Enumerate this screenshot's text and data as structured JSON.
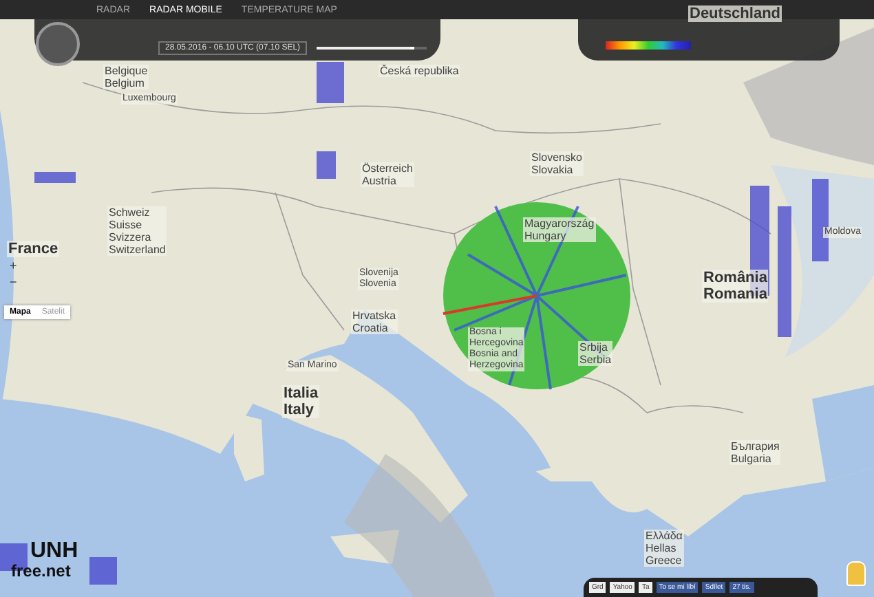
{
  "top_bar": {
    "tabs": [
      {
        "label": "RADAR",
        "selected": false
      },
      {
        "label": "RADAR MOBILE",
        "selected": true
      },
      {
        "label": "TEMPERATURE MAP",
        "selected": false
      }
    ]
  },
  "controls": {
    "date_range": "28.05.2016 - 06.10 UTC (07.10 SEL)",
    "opacity": {
      "level": 0.85
    }
  },
  "zoom": {
    "in": "+",
    "out": "−"
  },
  "map_types": [
    {
      "label": "Mapa",
      "selected": true
    },
    {
      "label": "Satelit",
      "selected": false
    }
  ],
  "map_labels": [
    {
      "text": "Deutschland",
      "kind": "big"
    },
    {
      "text": "Belgique\nBelgium",
      "kind": "country"
    },
    {
      "text": "Luxembourg",
      "kind": "small"
    },
    {
      "text": "Česká republika",
      "kind": "country"
    },
    {
      "text": "Slovensko\nSlovakia",
      "kind": "country"
    },
    {
      "text": "Österreich\nAustria",
      "kind": "country"
    },
    {
      "text": "France",
      "kind": "big"
    },
    {
      "text": "Schweiz\nSuisse\nSvizzera\nSwitzerland",
      "kind": "country"
    },
    {
      "text": "Magyarország\nHungary",
      "kind": "country"
    },
    {
      "text": "Slovenija\nSlovenia",
      "kind": "small"
    },
    {
      "text": "Hrvatska\nCroatia",
      "kind": "country"
    },
    {
      "text": "Bosna i\nHercegovina\nBosnia and\nHerzegovina",
      "kind": "small"
    },
    {
      "text": "Srbija\nSerbia",
      "kind": "country"
    },
    {
      "text": "România\nRomania",
      "kind": "big"
    },
    {
      "text": "Moldova",
      "kind": "small"
    },
    {
      "text": "Italia\nItaly",
      "kind": "big"
    },
    {
      "text": "San Marino",
      "kind": "small"
    },
    {
      "text": "България\nBulgaria",
      "kind": "country"
    },
    {
      "text": "Ελλάδα\nHellas\nGreece",
      "kind": "country"
    }
  ],
  "logo": {
    "line_1": "UNH",
    "line_2": "free.net"
  },
  "bottom_bar": {
    "items": [
      "Grd",
      "Yahoo",
      "Ta",
      "To se mi líbí",
      "Sdílet",
      "27 tis."
    ]
  }
}
